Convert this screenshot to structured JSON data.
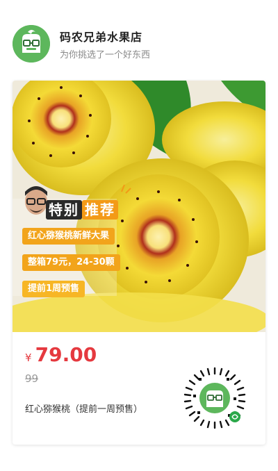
{
  "shop": {
    "name": "码农兄弟水果店",
    "subtitle": "为你挑选了一个好东西",
    "avatar_icon": "glasses-mascot-icon"
  },
  "product": {
    "promo_title_a": "特别",
    "promo_title_b": "推荐",
    "pills": [
      "红心猕猴桃新鲜大果",
      "整箱79元，24-30颗",
      "提前1周预售"
    ],
    "currency_symbol": "¥",
    "price": "79.00",
    "original_price": "99",
    "name": "红心猕猴桃（提前一周预售）"
  },
  "qr": {
    "icon": "mini-program-qr-icon"
  },
  "colors": {
    "price_red": "#e5393f",
    "brand_green": "#5db75c",
    "accent_orange": "#f2a41b",
    "kiwi_yellow": "#f3da3a"
  }
}
